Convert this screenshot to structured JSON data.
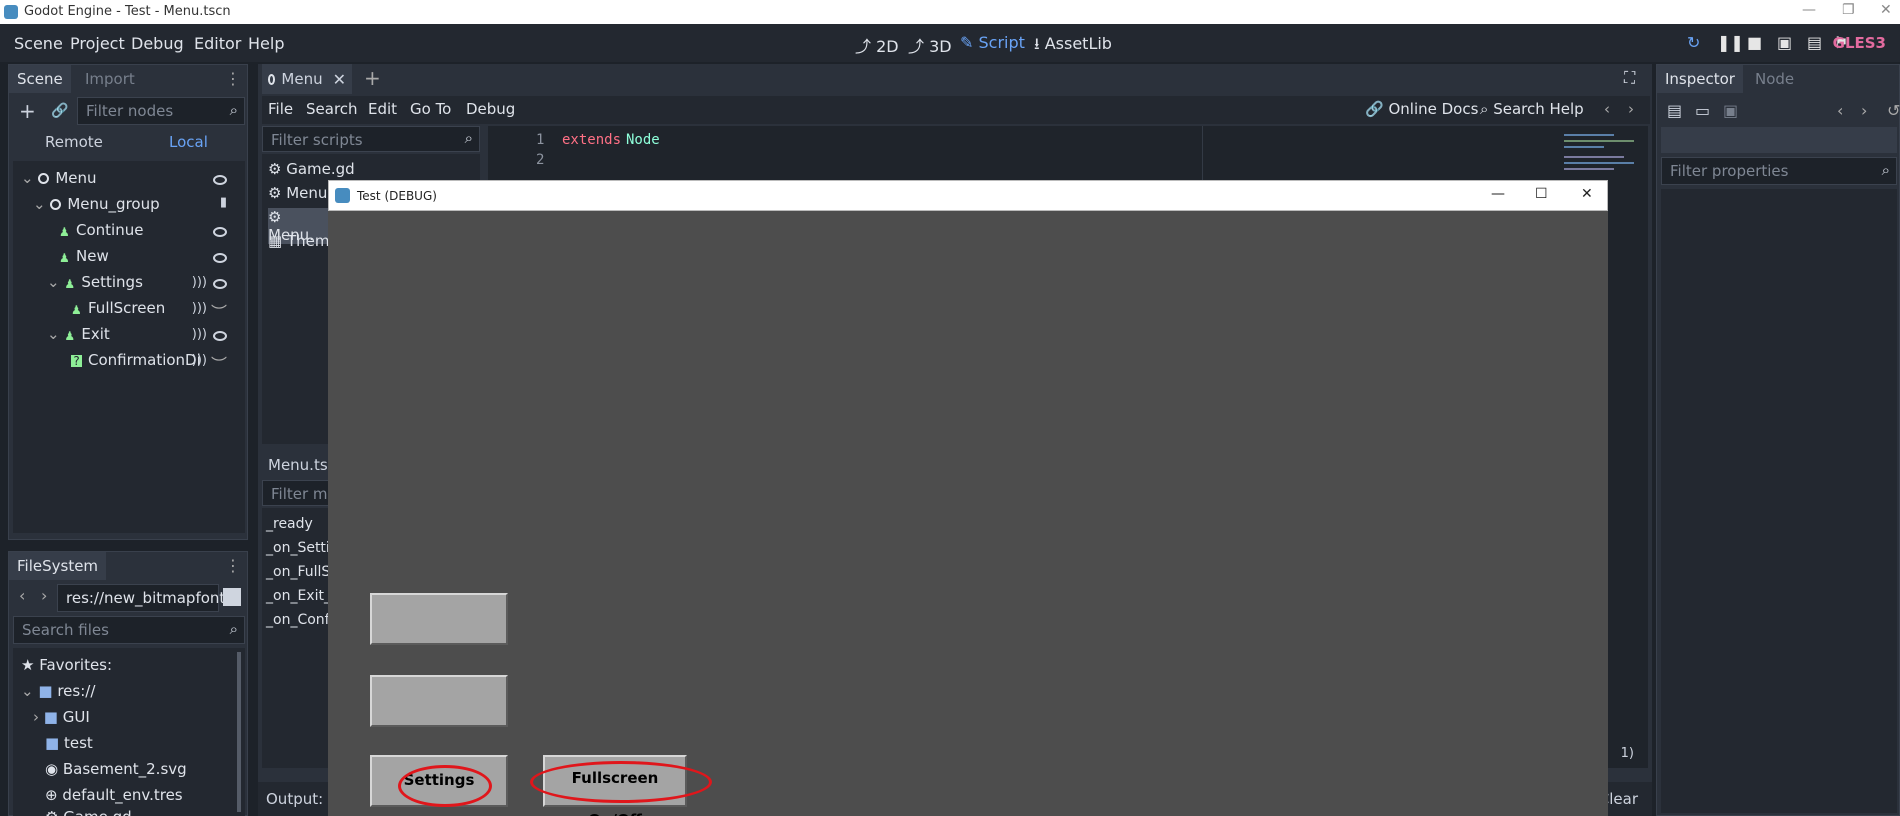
{
  "os_title": "Godot Engine - Test - Menu.tscn",
  "menubar": {
    "menus": [
      "Scene",
      "Project",
      "Debug",
      "Editor",
      "Help"
    ],
    "workspaces": [
      "2D",
      "3D",
      "Script",
      "AssetLib"
    ],
    "active_workspace": "Script",
    "renderer": "GLES3"
  },
  "scene_dock": {
    "tabs": [
      "Scene",
      "Import"
    ],
    "filter_placeholder": "Filter nodes",
    "remote_label": "Remote",
    "local_label": "Local",
    "nodes": [
      {
        "name": "Menu",
        "type": "node"
      },
      {
        "name": "Menu_group",
        "type": "node"
      },
      {
        "name": "Continue",
        "type": "control"
      },
      {
        "name": "New",
        "type": "control"
      },
      {
        "name": "Settings",
        "type": "control"
      },
      {
        "name": "FullScreen",
        "type": "control"
      },
      {
        "name": "Exit",
        "type": "control"
      },
      {
        "name": "ConfirmationDi",
        "type": "dialog"
      }
    ]
  },
  "filesystem_dock": {
    "tab": "FileSystem",
    "path": "res://new_bitmapfont.",
    "search_placeholder": "Search files",
    "items": [
      "Favorites:",
      "res://",
      "GUI",
      "test",
      "Basement_2.svg",
      "default_env.tres",
      "Game.gd"
    ]
  },
  "editor": {
    "tab": "Menu",
    "menus": [
      "File",
      "Search",
      "Edit",
      "Go To",
      "Debug"
    ],
    "online_docs": "Online Docs",
    "search_help": "Search Help",
    "filter_scripts_placeholder": "Filter scripts",
    "scripts": [
      "Game.gd",
      "Menu.",
      "Menu.",
      "Theme"
    ],
    "code_lines": [
      {
        "num": "1",
        "keyword": "extends",
        "ident": "Node"
      },
      {
        "num": "2",
        "keyword": "",
        "ident": ""
      }
    ],
    "methods_header": "Menu.tsc",
    "methods_filter_placeholder": "Filter me",
    "methods": [
      "_ready",
      "_on_Settin",
      "_on_FullS",
      "_on_Exit_",
      "_on_Conf"
    ],
    "output_label": "Output:",
    "clear_label": "Clear",
    "line_indicator": "1)"
  },
  "inspector": {
    "tabs": [
      "Inspector",
      "Node"
    ],
    "filter_placeholder": "Filter properties"
  },
  "debug_window": {
    "title": "Test (DEBUG)",
    "buttons": [
      {
        "label": "",
        "annotated": false
      },
      {
        "label": "",
        "annotated": false
      },
      {
        "label": "Settings",
        "annotated": true
      },
      {
        "label": "Fullscreen On/Off",
        "annotated": true
      }
    ],
    "annotation_color": "#e0161b"
  }
}
